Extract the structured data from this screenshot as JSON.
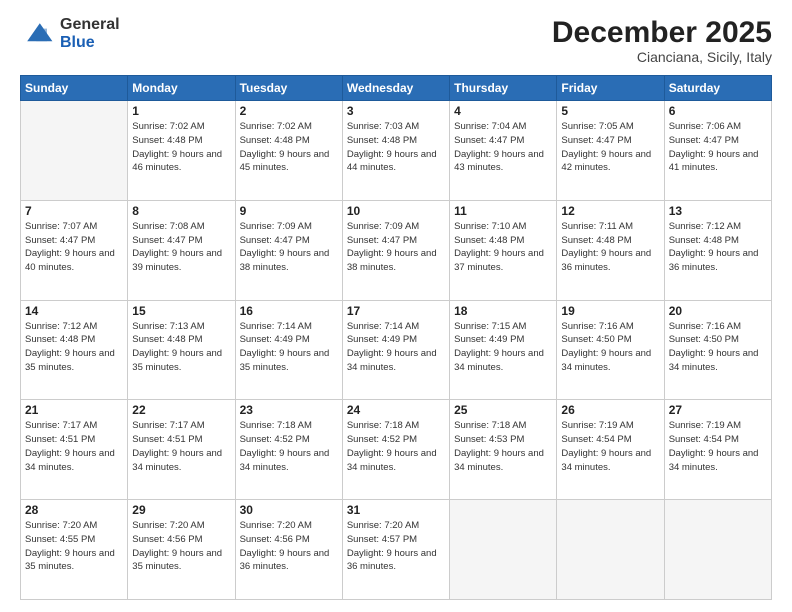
{
  "header": {
    "logo_general": "General",
    "logo_blue": "Blue",
    "month_title": "December 2025",
    "subtitle": "Cianciana, Sicily, Italy"
  },
  "days_of_week": [
    "Sunday",
    "Monday",
    "Tuesday",
    "Wednesday",
    "Thursday",
    "Friday",
    "Saturday"
  ],
  "weeks": [
    [
      {
        "day": "",
        "empty": true
      },
      {
        "day": "1",
        "sunrise": "7:02 AM",
        "sunset": "4:48 PM",
        "daylight": "9 hours and 46 minutes."
      },
      {
        "day": "2",
        "sunrise": "7:02 AM",
        "sunset": "4:48 PM",
        "daylight": "9 hours and 45 minutes."
      },
      {
        "day": "3",
        "sunrise": "7:03 AM",
        "sunset": "4:48 PM",
        "daylight": "9 hours and 44 minutes."
      },
      {
        "day": "4",
        "sunrise": "7:04 AM",
        "sunset": "4:47 PM",
        "daylight": "9 hours and 43 minutes."
      },
      {
        "day": "5",
        "sunrise": "7:05 AM",
        "sunset": "4:47 PM",
        "daylight": "9 hours and 42 minutes."
      },
      {
        "day": "6",
        "sunrise": "7:06 AM",
        "sunset": "4:47 PM",
        "daylight": "9 hours and 41 minutes."
      }
    ],
    [
      {
        "day": "7",
        "sunrise": "7:07 AM",
        "sunset": "4:47 PM",
        "daylight": "9 hours and 40 minutes."
      },
      {
        "day": "8",
        "sunrise": "7:08 AM",
        "sunset": "4:47 PM",
        "daylight": "9 hours and 39 minutes."
      },
      {
        "day": "9",
        "sunrise": "7:09 AM",
        "sunset": "4:47 PM",
        "daylight": "9 hours and 38 minutes."
      },
      {
        "day": "10",
        "sunrise": "7:09 AM",
        "sunset": "4:47 PM",
        "daylight": "9 hours and 38 minutes."
      },
      {
        "day": "11",
        "sunrise": "7:10 AM",
        "sunset": "4:48 PM",
        "daylight": "9 hours and 37 minutes."
      },
      {
        "day": "12",
        "sunrise": "7:11 AM",
        "sunset": "4:48 PM",
        "daylight": "9 hours and 36 minutes."
      },
      {
        "day": "13",
        "sunrise": "7:12 AM",
        "sunset": "4:48 PM",
        "daylight": "9 hours and 36 minutes."
      }
    ],
    [
      {
        "day": "14",
        "sunrise": "7:12 AM",
        "sunset": "4:48 PM",
        "daylight": "9 hours and 35 minutes."
      },
      {
        "day": "15",
        "sunrise": "7:13 AM",
        "sunset": "4:48 PM",
        "daylight": "9 hours and 35 minutes."
      },
      {
        "day": "16",
        "sunrise": "7:14 AM",
        "sunset": "4:49 PM",
        "daylight": "9 hours and 35 minutes."
      },
      {
        "day": "17",
        "sunrise": "7:14 AM",
        "sunset": "4:49 PM",
        "daylight": "9 hours and 34 minutes."
      },
      {
        "day": "18",
        "sunrise": "7:15 AM",
        "sunset": "4:49 PM",
        "daylight": "9 hours and 34 minutes."
      },
      {
        "day": "19",
        "sunrise": "7:16 AM",
        "sunset": "4:50 PM",
        "daylight": "9 hours and 34 minutes."
      },
      {
        "day": "20",
        "sunrise": "7:16 AM",
        "sunset": "4:50 PM",
        "daylight": "9 hours and 34 minutes."
      }
    ],
    [
      {
        "day": "21",
        "sunrise": "7:17 AM",
        "sunset": "4:51 PM",
        "daylight": "9 hours and 34 minutes."
      },
      {
        "day": "22",
        "sunrise": "7:17 AM",
        "sunset": "4:51 PM",
        "daylight": "9 hours and 34 minutes."
      },
      {
        "day": "23",
        "sunrise": "7:18 AM",
        "sunset": "4:52 PM",
        "daylight": "9 hours and 34 minutes."
      },
      {
        "day": "24",
        "sunrise": "7:18 AM",
        "sunset": "4:52 PM",
        "daylight": "9 hours and 34 minutes."
      },
      {
        "day": "25",
        "sunrise": "7:18 AM",
        "sunset": "4:53 PM",
        "daylight": "9 hours and 34 minutes."
      },
      {
        "day": "26",
        "sunrise": "7:19 AM",
        "sunset": "4:54 PM",
        "daylight": "9 hours and 34 minutes."
      },
      {
        "day": "27",
        "sunrise": "7:19 AM",
        "sunset": "4:54 PM",
        "daylight": "9 hours and 34 minutes."
      }
    ],
    [
      {
        "day": "28",
        "sunrise": "7:20 AM",
        "sunset": "4:55 PM",
        "daylight": "9 hours and 35 minutes."
      },
      {
        "day": "29",
        "sunrise": "7:20 AM",
        "sunset": "4:56 PM",
        "daylight": "9 hours and 35 minutes."
      },
      {
        "day": "30",
        "sunrise": "7:20 AM",
        "sunset": "4:56 PM",
        "daylight": "9 hours and 36 minutes."
      },
      {
        "day": "31",
        "sunrise": "7:20 AM",
        "sunset": "4:57 PM",
        "daylight": "9 hours and 36 minutes."
      },
      {
        "day": "",
        "empty": true
      },
      {
        "day": "",
        "empty": true
      },
      {
        "day": "",
        "empty": true
      }
    ]
  ],
  "labels": {
    "sunrise": "Sunrise:",
    "sunset": "Sunset:",
    "daylight": "Daylight:"
  }
}
